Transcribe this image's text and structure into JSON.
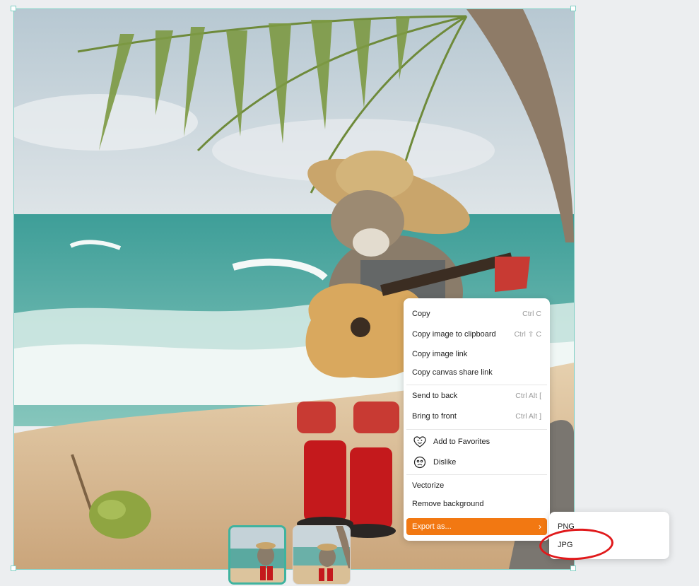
{
  "context_menu": {
    "copy": {
      "label": "Copy",
      "shortcut": "Ctrl C"
    },
    "copy_image": {
      "label": "Copy image to clipboard",
      "shortcut": "Ctrl ⇧ C"
    },
    "copy_link": {
      "label": "Copy image link"
    },
    "copy_canvas_link": {
      "label": "Copy canvas share link"
    },
    "send_back": {
      "label": "Send to back",
      "shortcut": "Ctrl Alt ["
    },
    "bring_front": {
      "label": "Bring to front",
      "shortcut": "Ctrl Alt ]"
    },
    "favorites": {
      "label": "Add to Favorites",
      "icon": "heart-face-icon"
    },
    "dislike": {
      "label": "Dislike",
      "icon": "frown-face-icon"
    },
    "vectorize": {
      "label": "Vectorize"
    },
    "remove_bg": {
      "label": "Remove background"
    },
    "export": {
      "label": "Export as...",
      "icon": "chevron-right-icon"
    }
  },
  "export_submenu": {
    "png": "PNG",
    "jpg": "JPG"
  },
  "colors": {
    "highlight": "#f27812",
    "selection": "#7fcfc4",
    "thumb_active": "#3fb39f",
    "annotation": "#e0191b"
  }
}
